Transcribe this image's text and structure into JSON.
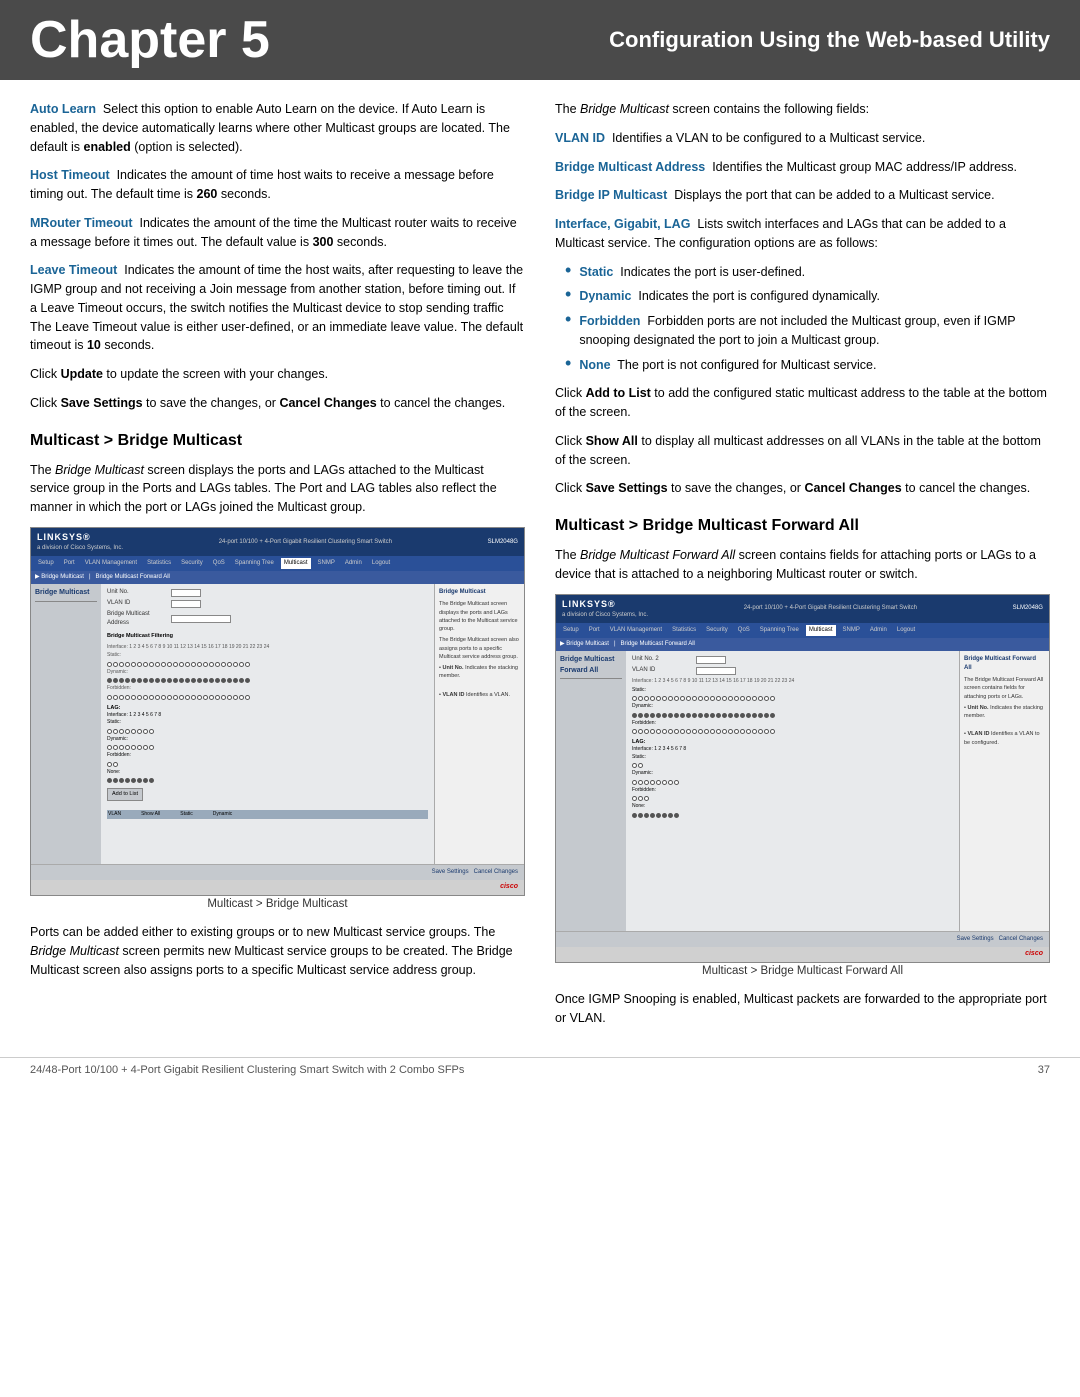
{
  "header": {
    "chapter_label": "Chapter 5",
    "subtitle": "Configuration Using the Web-based Utility"
  },
  "left_col": {
    "paragraphs": [
      {
        "term": "Auto Learn",
        "body": "Select this option to enable Auto Learn on the device. If Auto Learn is enabled, the device automatically learns where other Multicast groups are located. The default is ",
        "bold": "enabled",
        "body2": " (option is selected)."
      },
      {
        "term": "Host Timeout",
        "body": "Indicates the amount of time host waits to receive a message before timing out. The default time is ",
        "bold": "260",
        "body2": " seconds."
      },
      {
        "term": "MRouter Timeout",
        "body": "Indicates the amount of the time the Multicast router waits to receive a message before it times out. The default value is ",
        "bold": "300",
        "body2": " seconds."
      },
      {
        "term": "Leave Timeout",
        "body": "Indicates the amount of time the host waits, after requesting to leave the IGMP group and not receiving a Join message from another station, before timing out. If a Leave Timeout occurs, the switch notifies the Multicast device to stop sending traffic The Leave Timeout value is either user-defined, or an immediate leave value. The default timeout is ",
        "bold": "10",
        "body2": " seconds."
      }
    ],
    "click_update": "Click ",
    "click_update_bold": "Update",
    "click_update_after": " to update the screen with your changes.",
    "click_save": "Click ",
    "click_save_bold": "Save Settings",
    "click_save_mid": " to save the changes, or ",
    "click_cancel_bold": "Cancel Changes",
    "click_cancel_after": " to cancel the changes.",
    "section_heading": "Multicast > Bridge Multicast",
    "section_intro": "The ",
    "section_italic": "Bridge Multicast",
    "section_body": " screen displays the ports and LAGs attached to the Multicast service group in the Ports and LAGs tables. The Port and LAG tables also reflect the manner in which the port or LAGs joined the Multicast group.",
    "screenshot_caption": "Multicast > Bridge Multicast",
    "post_screenshot_p1": "Ports can be added either to existing groups or to new Multicast service groups. The ",
    "post_screenshot_italic": "Bridge Multicast",
    "post_screenshot_p1b": " screen permits new Multicast service groups to be created. The Bridge Multicast screen also assigns ports to a specific Multicast service address group."
  },
  "right_col": {
    "intro": "The ",
    "intro_italic": "Bridge Multicast",
    "intro_body": " screen contains the following fields:",
    "fields": [
      {
        "term": "VLAN ID",
        "body": "Identifies a VLAN to be configured to a Multicast service."
      },
      {
        "term": "Bridge Multicast Address",
        "body": "Identifies the Multicast group MAC address/IP address."
      },
      {
        "term": "Bridge IP Multicast",
        "body": "Displays the port that can be added to a Multicast service."
      },
      {
        "term": "Interface, Gigabit, LAG",
        "body": "Lists switch interfaces and LAGs that can be added to a Multicast service. The configuration options are as follows:"
      }
    ],
    "bullet_items": [
      {
        "term": "Static",
        "body": "Indicates the port is user-defined."
      },
      {
        "term": "Dynamic",
        "body": "Indicates the port is configured dynamically."
      },
      {
        "term": "Forbidden",
        "body": "Forbidden ports are not included the Multicast group, even if IGMP snooping designated the port to join a Multicast group."
      },
      {
        "term": "None",
        "body": "The port is not configured for Multicast service."
      }
    ],
    "click_add": "Click ",
    "click_add_bold": "Add to List",
    "click_add_after": " to add the configured static multicast address to the table at the bottom of the screen.",
    "click_show": "Click ",
    "click_show_bold": "Show All",
    "click_show_after": " to display all multicast addresses on all VLANs in the table at the bottom of the screen.",
    "click_save": "Click ",
    "click_save_bold": "Save Settings",
    "click_save_mid": " to save the changes, or ",
    "click_cancel_bold": "Cancel Changes",
    "click_cancel_after": " to cancel the changes.",
    "section2_heading": "Multicast > Bridge Multicast Forward All",
    "section2_intro": "The ",
    "section2_italic": "Bridge Multicast Forward All",
    "section2_body": " screen contains fields for attaching ports or LAGs to a device that is attached to a neighboring Multicast router or switch.",
    "screenshot2_caption": "Multicast > Bridge Multicast Forward All",
    "post_screenshot2": "Once IGMP Snooping is enabled, Multicast packets are forwarded to the appropriate port or VLAN."
  },
  "footer": {
    "left": "24/48-Port 10/100 + 4-Port Gigabit Resilient Clustering Smart Switch with 2 Combo SFPs",
    "right": "37"
  },
  "ui_mock": {
    "nav_items": [
      "Setup",
      "Port",
      "VLAN",
      "Statistics",
      "Security",
      "QoS",
      "Spanning Tree",
      "Multicast",
      "SNMP",
      "Admin",
      "Logout"
    ],
    "sidebar_title": "Bridge Multicast",
    "save_cancel": "Save Settings  Cancel Changes"
  }
}
